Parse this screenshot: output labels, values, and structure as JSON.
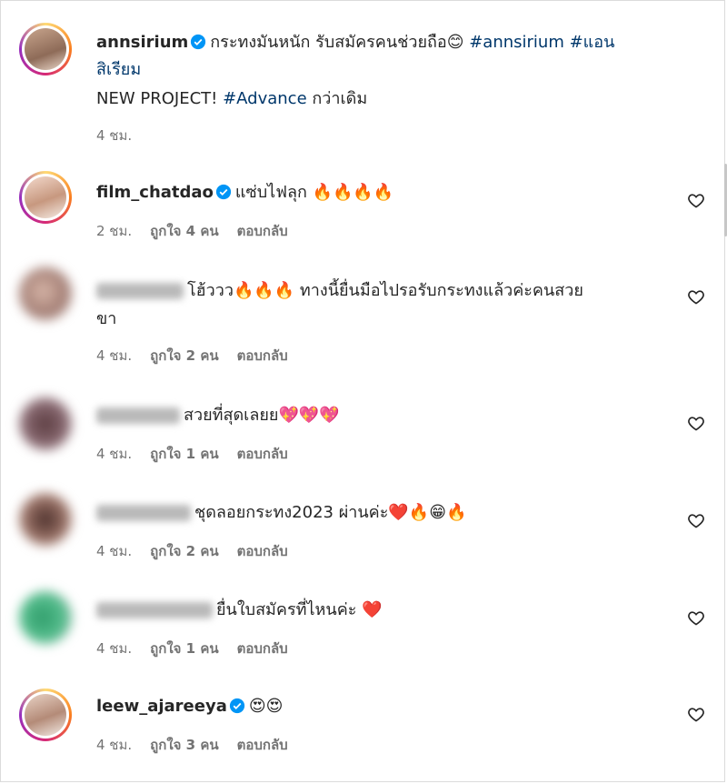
{
  "post": {
    "username": "annsirium",
    "caption_line1": "กระทงมันหนัก รับสมัครคนช่วยถือ😊 ",
    "hashtag1": "#annsirium",
    "hashtag2": " #แอน",
    "hashtag2_cont": "สิเรียม",
    "caption_line2_a": "NEW PROJECT! ",
    "hashtag3": "#Advance",
    "caption_line2_b": " กว่าเดิม",
    "time": "4 ชม."
  },
  "comments": [
    {
      "username": "film_chatdao",
      "verified": true,
      "text": "แซ่บไฟลุก 🔥🔥🔥🔥",
      "time": "2 ชม.",
      "likes": "ถูกใจ 4 คน",
      "reply": "ตอบกลับ",
      "avatar_color": "#e8c2b0"
    },
    {
      "username": "",
      "verified": false,
      "text": "โฮ้ววว🔥🔥🔥 ทางนี้ยื่นมือไปรอรับกระทงแล้วค่ะคนสวย",
      "text_cont": "ขา",
      "time": "4 ชม.",
      "likes": "ถูกใจ 2 คน",
      "reply": "ตอบกลับ",
      "avatar_color": "#c9a59a"
    },
    {
      "username": "",
      "verified": false,
      "text": "สวยที่สุดเลยย💖💖💖",
      "time": "4 ชม.",
      "likes": "ถูกใจ 1 คน",
      "reply": "ตอบกลับ",
      "avatar_color": "#6b4a4a"
    },
    {
      "username": "",
      "verified": false,
      "text": "ชุดลอยกระทง2023 ผ่านค่ะ❤️🔥😁🔥",
      "time": "4 ชม.",
      "likes": "ถูกใจ 2 คน",
      "reply": "ตอบกลับ",
      "avatar_color": "#7a5850"
    },
    {
      "username": "",
      "verified": false,
      "text": "ยื่นใบสมัครที่ไหนค่ะ ❤️",
      "time": "4 ชม.",
      "likes": "ถูกใจ 1 คน",
      "reply": "ตอบกลับ",
      "avatar_color": "#3fae7e"
    },
    {
      "username": "leew_ajareeya",
      "verified": true,
      "text": "😍😍",
      "time": "4 ชม.",
      "likes": "ถูกใจ 3 คน",
      "reply": "ตอบกลับ",
      "avatar_color": "#d9b8a8"
    }
  ],
  "colors": {
    "verified": "#0095f6",
    "hashtag": "#00376b",
    "meta": "#737373"
  }
}
